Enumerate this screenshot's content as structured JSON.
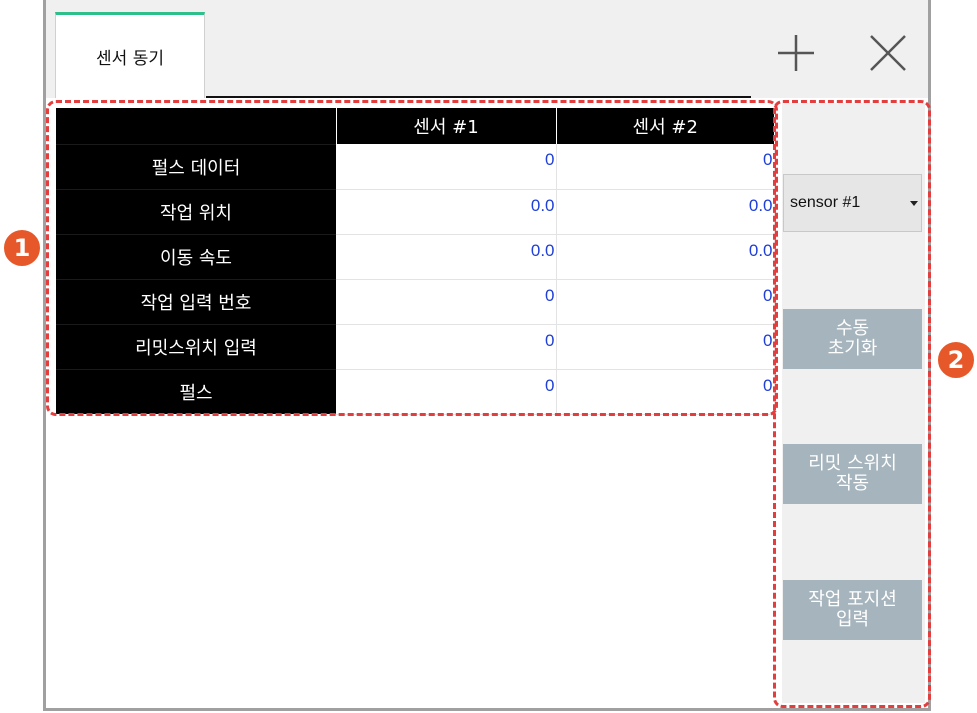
{
  "tab": {
    "label": "센서 동기"
  },
  "table": {
    "headers": [
      "",
      "센서 #1",
      "센서 #2"
    ],
    "rows": [
      {
        "label": "펄스 데이터",
        "values": [
          "0",
          "0"
        ]
      },
      {
        "label": "작업 위치",
        "values": [
          "0.0",
          "0.0"
        ]
      },
      {
        "label": "이동 속도",
        "values": [
          "0.0",
          "0.0"
        ]
      },
      {
        "label": "작업 입력 번호",
        "values": [
          "0",
          "0"
        ]
      },
      {
        "label": "리밋스위치 입력",
        "values": [
          "0",
          "0"
        ]
      },
      {
        "label": "펄스",
        "values": [
          "0",
          "0"
        ]
      }
    ]
  },
  "side": {
    "select_value": "sensor #1",
    "manual_init": "수동\n초기화",
    "limit_switch": "리밋 스위치\n작동",
    "position_input": "작업 포지션\n입력"
  },
  "annotations": {
    "badge1": "1",
    "badge2": "2"
  },
  "colors": {
    "accent_tab": "#2dc08a",
    "value_text": "#1f3fd6",
    "button_bg": "#a6b5bd",
    "annotation": "#e33d3d",
    "badge": "#e6582a"
  },
  "icons": {
    "add": "plus-icon",
    "close": "close-icon"
  }
}
